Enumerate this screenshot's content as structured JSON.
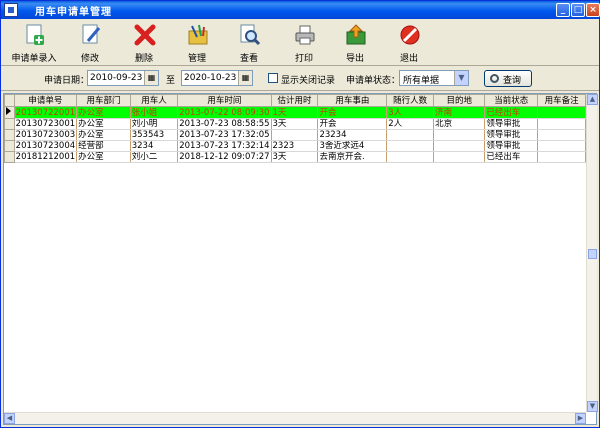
{
  "window": {
    "title": "用车申请单管理"
  },
  "toolbar": {
    "items": [
      {
        "label": "申请单录入",
        "icon": "add-document-icon"
      },
      {
        "label": "修改",
        "icon": "edit-document-icon"
      },
      {
        "label": "删除",
        "icon": "delete-x-icon"
      },
      {
        "label": "管理",
        "icon": "manage-folder-icon"
      },
      {
        "label": "查看",
        "icon": "view-magnifier-icon"
      },
      {
        "label": "打印",
        "icon": "printer-icon"
      },
      {
        "label": "导出",
        "icon": "export-icon"
      },
      {
        "label": "退出",
        "icon": "exit-icon"
      }
    ]
  },
  "filter": {
    "date_label": "申请日期：",
    "date_from": "2010-09-23",
    "to_label": "至",
    "date_to": "2020-10-23",
    "show_closed_label": "显示关闭记录",
    "status_label": "申请单状态：",
    "status_value": "所有单据",
    "query_label": "查询"
  },
  "grid": {
    "columns": [
      "申请单号",
      "用车部门",
      "用车人",
      "用车时间",
      "估计用时",
      "用车事由",
      "随行人数",
      "目的地",
      "当前状态",
      "用车备注"
    ],
    "rows": [
      [
        "20130722001",
        "办公室",
        "张小姐",
        "2013-07-22 08:09:30",
        "1天",
        "开会",
        "3人",
        "济南",
        "已经出车",
        ""
      ],
      [
        "20130723001",
        "办公室",
        "刘小明",
        "2013-07-23 08:58:55",
        "3天",
        "开会",
        "2人",
        "北京",
        "领导审批",
        ""
      ],
      [
        "20130723003",
        "办公室",
        "353543",
        "2013-07-23 17:32:05",
        "",
        "23234",
        "",
        "",
        "领导审批",
        ""
      ],
      [
        "20130723004",
        "经营部",
        "3234",
        "2013-07-23 17:32:14",
        "2323",
        "3舍近求远4",
        "",
        "",
        "领导审批",
        ""
      ],
      [
        "20181212001",
        "办公室",
        "刘小二",
        "2018-12-12 09:07:27",
        "3天",
        "去南京开会.",
        "",
        "",
        "已经出车",
        ""
      ]
    ],
    "selected_row": 0
  }
}
